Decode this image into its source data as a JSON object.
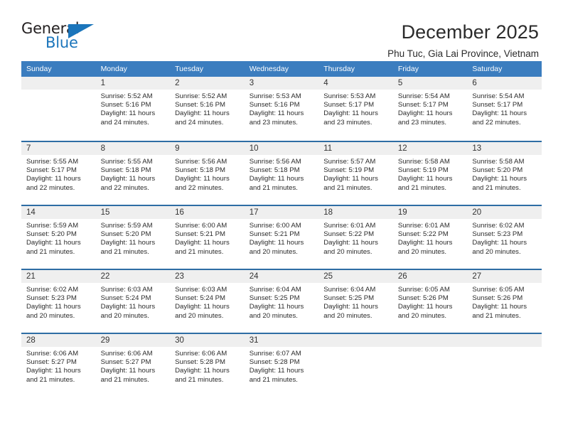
{
  "brand": {
    "name_part1": "General",
    "name_part2": "Blue",
    "accent_color": "#1b75bb"
  },
  "header": {
    "month_title": "December 2025",
    "location": "Phu Tuc, Gia Lai Province, Vietnam"
  },
  "calendar": {
    "header_color": "#3b7dbf",
    "separator_color": "#2e6da4",
    "daynum_band_color": "#efefef",
    "weekday_headers": [
      "Sunday",
      "Monday",
      "Tuesday",
      "Wednesday",
      "Thursday",
      "Friday",
      "Saturday"
    ],
    "weeks": [
      [
        {
          "day": "",
          "sunrise": "",
          "sunset": "",
          "daylight_line1": "",
          "daylight_line2": "",
          "empty": true
        },
        {
          "day": "1",
          "sunrise": "Sunrise: 5:52 AM",
          "sunset": "Sunset: 5:16 PM",
          "daylight_line1": "Daylight: 11 hours",
          "daylight_line2": "and 24 minutes."
        },
        {
          "day": "2",
          "sunrise": "Sunrise: 5:52 AM",
          "sunset": "Sunset: 5:16 PM",
          "daylight_line1": "Daylight: 11 hours",
          "daylight_line2": "and 24 minutes."
        },
        {
          "day": "3",
          "sunrise": "Sunrise: 5:53 AM",
          "sunset": "Sunset: 5:16 PM",
          "daylight_line1": "Daylight: 11 hours",
          "daylight_line2": "and 23 minutes."
        },
        {
          "day": "4",
          "sunrise": "Sunrise: 5:53 AM",
          "sunset": "Sunset: 5:17 PM",
          "daylight_line1": "Daylight: 11 hours",
          "daylight_line2": "and 23 minutes."
        },
        {
          "day": "5",
          "sunrise": "Sunrise: 5:54 AM",
          "sunset": "Sunset: 5:17 PM",
          "daylight_line1": "Daylight: 11 hours",
          "daylight_line2": "and 23 minutes."
        },
        {
          "day": "6",
          "sunrise": "Sunrise: 5:54 AM",
          "sunset": "Sunset: 5:17 PM",
          "daylight_line1": "Daylight: 11 hours",
          "daylight_line2": "and 22 minutes."
        }
      ],
      [
        {
          "day": "7",
          "sunrise": "Sunrise: 5:55 AM",
          "sunset": "Sunset: 5:17 PM",
          "daylight_line1": "Daylight: 11 hours",
          "daylight_line2": "and 22 minutes."
        },
        {
          "day": "8",
          "sunrise": "Sunrise: 5:55 AM",
          "sunset": "Sunset: 5:18 PM",
          "daylight_line1": "Daylight: 11 hours",
          "daylight_line2": "and 22 minutes."
        },
        {
          "day": "9",
          "sunrise": "Sunrise: 5:56 AM",
          "sunset": "Sunset: 5:18 PM",
          "daylight_line1": "Daylight: 11 hours",
          "daylight_line2": "and 22 minutes."
        },
        {
          "day": "10",
          "sunrise": "Sunrise: 5:56 AM",
          "sunset": "Sunset: 5:18 PM",
          "daylight_line1": "Daylight: 11 hours",
          "daylight_line2": "and 21 minutes."
        },
        {
          "day": "11",
          "sunrise": "Sunrise: 5:57 AM",
          "sunset": "Sunset: 5:19 PM",
          "daylight_line1": "Daylight: 11 hours",
          "daylight_line2": "and 21 minutes."
        },
        {
          "day": "12",
          "sunrise": "Sunrise: 5:58 AM",
          "sunset": "Sunset: 5:19 PM",
          "daylight_line1": "Daylight: 11 hours",
          "daylight_line2": "and 21 minutes."
        },
        {
          "day": "13",
          "sunrise": "Sunrise: 5:58 AM",
          "sunset": "Sunset: 5:20 PM",
          "daylight_line1": "Daylight: 11 hours",
          "daylight_line2": "and 21 minutes."
        }
      ],
      [
        {
          "day": "14",
          "sunrise": "Sunrise: 5:59 AM",
          "sunset": "Sunset: 5:20 PM",
          "daylight_line1": "Daylight: 11 hours",
          "daylight_line2": "and 21 minutes."
        },
        {
          "day": "15",
          "sunrise": "Sunrise: 5:59 AM",
          "sunset": "Sunset: 5:20 PM",
          "daylight_line1": "Daylight: 11 hours",
          "daylight_line2": "and 21 minutes."
        },
        {
          "day": "16",
          "sunrise": "Sunrise: 6:00 AM",
          "sunset": "Sunset: 5:21 PM",
          "daylight_line1": "Daylight: 11 hours",
          "daylight_line2": "and 21 minutes."
        },
        {
          "day": "17",
          "sunrise": "Sunrise: 6:00 AM",
          "sunset": "Sunset: 5:21 PM",
          "daylight_line1": "Daylight: 11 hours",
          "daylight_line2": "and 20 minutes."
        },
        {
          "day": "18",
          "sunrise": "Sunrise: 6:01 AM",
          "sunset": "Sunset: 5:22 PM",
          "daylight_line1": "Daylight: 11 hours",
          "daylight_line2": "and 20 minutes."
        },
        {
          "day": "19",
          "sunrise": "Sunrise: 6:01 AM",
          "sunset": "Sunset: 5:22 PM",
          "daylight_line1": "Daylight: 11 hours",
          "daylight_line2": "and 20 minutes."
        },
        {
          "day": "20",
          "sunrise": "Sunrise: 6:02 AM",
          "sunset": "Sunset: 5:23 PM",
          "daylight_line1": "Daylight: 11 hours",
          "daylight_line2": "and 20 minutes."
        }
      ],
      [
        {
          "day": "21",
          "sunrise": "Sunrise: 6:02 AM",
          "sunset": "Sunset: 5:23 PM",
          "daylight_line1": "Daylight: 11 hours",
          "daylight_line2": "and 20 minutes."
        },
        {
          "day": "22",
          "sunrise": "Sunrise: 6:03 AM",
          "sunset": "Sunset: 5:24 PM",
          "daylight_line1": "Daylight: 11 hours",
          "daylight_line2": "and 20 minutes."
        },
        {
          "day": "23",
          "sunrise": "Sunrise: 6:03 AM",
          "sunset": "Sunset: 5:24 PM",
          "daylight_line1": "Daylight: 11 hours",
          "daylight_line2": "and 20 minutes."
        },
        {
          "day": "24",
          "sunrise": "Sunrise: 6:04 AM",
          "sunset": "Sunset: 5:25 PM",
          "daylight_line1": "Daylight: 11 hours",
          "daylight_line2": "and 20 minutes."
        },
        {
          "day": "25",
          "sunrise": "Sunrise: 6:04 AM",
          "sunset": "Sunset: 5:25 PM",
          "daylight_line1": "Daylight: 11 hours",
          "daylight_line2": "and 20 minutes."
        },
        {
          "day": "26",
          "sunrise": "Sunrise: 6:05 AM",
          "sunset": "Sunset: 5:26 PM",
          "daylight_line1": "Daylight: 11 hours",
          "daylight_line2": "and 20 minutes."
        },
        {
          "day": "27",
          "sunrise": "Sunrise: 6:05 AM",
          "sunset": "Sunset: 5:26 PM",
          "daylight_line1": "Daylight: 11 hours",
          "daylight_line2": "and 21 minutes."
        }
      ],
      [
        {
          "day": "28",
          "sunrise": "Sunrise: 6:06 AM",
          "sunset": "Sunset: 5:27 PM",
          "daylight_line1": "Daylight: 11 hours",
          "daylight_line2": "and 21 minutes."
        },
        {
          "day": "29",
          "sunrise": "Sunrise: 6:06 AM",
          "sunset": "Sunset: 5:27 PM",
          "daylight_line1": "Daylight: 11 hours",
          "daylight_line2": "and 21 minutes."
        },
        {
          "day": "30",
          "sunrise": "Sunrise: 6:06 AM",
          "sunset": "Sunset: 5:28 PM",
          "daylight_line1": "Daylight: 11 hours",
          "daylight_line2": "and 21 minutes."
        },
        {
          "day": "31",
          "sunrise": "Sunrise: 6:07 AM",
          "sunset": "Sunset: 5:28 PM",
          "daylight_line1": "Daylight: 11 hours",
          "daylight_line2": "and 21 minutes."
        },
        {
          "day": "",
          "sunrise": "",
          "sunset": "",
          "daylight_line1": "",
          "daylight_line2": "",
          "empty": true
        },
        {
          "day": "",
          "sunrise": "",
          "sunset": "",
          "daylight_line1": "",
          "daylight_line2": "",
          "empty": true
        },
        {
          "day": "",
          "sunrise": "",
          "sunset": "",
          "daylight_line1": "",
          "daylight_line2": "",
          "empty": true
        }
      ]
    ]
  }
}
